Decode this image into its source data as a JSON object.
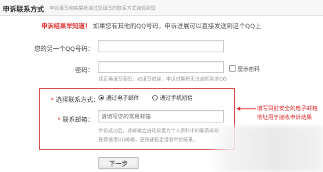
{
  "header": {
    "title": "申诉联系方式",
    "description": "申诉填写和结果将通过您填写的联系方式通知到您"
  },
  "notice": {
    "highlight": "申诉结果早知道！",
    "text": "如果您有其他的QQ号码，申诉进展可以直接发送到这个QQ上"
  },
  "qq_field": {
    "label": "您的另一个QQ号码：",
    "value": ""
  },
  "password_field": {
    "label": "密码：",
    "value": "",
    "hint": "请正确填写密码，如填写错误，申诉进展将无法通知到该QQ",
    "show_password_label": "显示密码"
  },
  "contact_method": {
    "label": "选择联系方式：",
    "options": [
      {
        "label": "通过电子邮件",
        "selected": true
      },
      {
        "label": "通过手机短信",
        "selected": false
      }
    ]
  },
  "email_field": {
    "label": "联系邮箱：",
    "placeholder": "请填写您的常用邮箱",
    "hint_line1": "申诉成功后，此邮箱会自动设置为个人资料中的联系邮箱",
    "hint_line2": "推荐使用QQ邮箱，更快速稳定接收申诉结果。"
  },
  "next_button": {
    "label": "下一步"
  },
  "annotation": {
    "line1": "填写目前安全的电子邮箱",
    "line2": "地址用于接收申诉结果"
  },
  "colors": {
    "accent_red": "#e03030",
    "box_border": "#d64545",
    "hint_gray": "#9a9a9a"
  }
}
